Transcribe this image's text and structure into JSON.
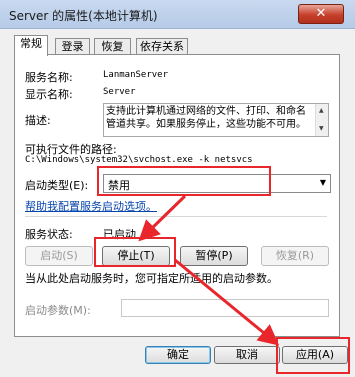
{
  "window": {
    "title": "Server 的属性(本地计算机)",
    "close_label": "✕"
  },
  "tabs": [
    {
      "label": "常规",
      "active": true
    },
    {
      "label": "登录",
      "active": false
    },
    {
      "label": "恢复",
      "active": false
    },
    {
      "label": "依存关系",
      "active": false
    }
  ],
  "general": {
    "service_name_label": "服务名称:",
    "service_name_value": "LanmanServer",
    "display_name_label": "显示名称:",
    "display_name_value": "Server",
    "description_label": "描述:",
    "description_text": "支持此计算机通过网络的文件、打印、和命名管道共享。如果服务停止，这些功能不可用。",
    "exe_path_label": "可执行文件的路径:",
    "exe_path_value": "C:\\Windows\\system32\\svchost.exe -k netsvcs",
    "startup_type_label": "启动类型(E):",
    "startup_type_value": "禁用",
    "help_link": "帮助我配置服务启动选项。",
    "status_label": "服务状态:",
    "status_value": "已启动",
    "buttons": {
      "start": "启动(S)",
      "stop": "停止(T)",
      "pause": "暂停(P)",
      "resume": "恢复(R)"
    },
    "hint_text": "当从此处启动服务时，您可指定所适用的启动参数。",
    "start_params_label": "启动参数(M):",
    "start_params_value": ""
  },
  "footer": {
    "ok": "确定",
    "cancel": "取消",
    "apply": "应用(A)"
  },
  "colors": {
    "highlight": "#e8262b",
    "link": "#0645ad"
  },
  "icons": [
    "close-icon",
    "scroll-up-icon",
    "scroll-down-icon",
    "dropdown-arrow-icon"
  ]
}
